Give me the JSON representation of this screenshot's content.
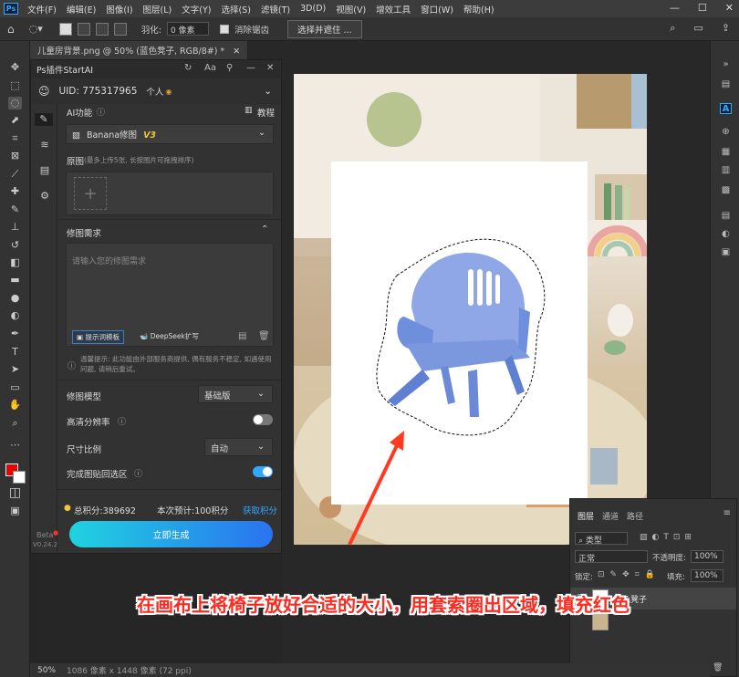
{
  "menubar": {
    "logo": "Ps",
    "items": [
      "文件(F)",
      "编辑(E)",
      "图像(I)",
      "图层(L)",
      "文字(Y)",
      "选择(S)",
      "滤镜(T)",
      "3D(D)",
      "视图(V)",
      "增效工具",
      "窗口(W)",
      "帮助(H)"
    ]
  },
  "options": {
    "feather_label": "羽化:",
    "feather_value": "0 像素",
    "antialias_label": "消除锯齿",
    "select_mask_button": "选择并遮住 ..."
  },
  "document_tab": {
    "title": "儿童房背景.png @ 50% (蓝色凳子, RGB/8#) *"
  },
  "plugin": {
    "title": "Ps插件StartAI",
    "uid": "UID: 775317965",
    "account_type": "个人",
    "ai_function_label": "AI功能",
    "tutorial_label": "教程",
    "model_dropdown": "Banana修图",
    "model_version": "V3",
    "original_label": "原图",
    "original_hint": "(最多上传5张, 长按图片可拖拽排序)",
    "requirements_label": "修图需求",
    "requirements_placeholder": "请输入您的修图需求",
    "prompt_template_button": "提示词模板",
    "deepseek_button": "DeepSeek扩写",
    "tip_text": "温馨提示: 此功能由外部服务商提供, 偶有服务不稳定, 如遇使用问题, 请稍后重试。",
    "model_label": "修图模型",
    "model_value": "基础版",
    "hd_label": "高清分辨率",
    "ratio_label": "尺寸比例",
    "ratio_value": "自动",
    "paste_back_label": "完成图贴回选区",
    "points_total": "总积分:389692",
    "points_estimate": "本次预计:100积分",
    "get_points": "获取积分",
    "generate_button": "立即生成",
    "beta_label": "Beta",
    "version_label": "V0.24.2"
  },
  "layers": {
    "tabs": [
      "图层",
      "通道",
      "路径"
    ],
    "filter_label": "类型",
    "blend_mode": "正常",
    "opacity_label": "不透明度:",
    "opacity_value": "100%",
    "lock_label": "锁定:",
    "fill_label": "填充:",
    "fill_value": "100%",
    "layer_name": "蓝色凳子"
  },
  "status": {
    "zoom": "50%",
    "doc_size": "1086 像素 x 1448 像素 (72 ppi)"
  },
  "caption": "在画布上将椅子放好合适的大小，用套索圈出区域，填充红色",
  "colors": {
    "foreground": "#e00000",
    "background": "#ffffff",
    "accent": "#31a8ff",
    "toggle_on": "#31a8ff",
    "caption": "#ff2a1f"
  }
}
